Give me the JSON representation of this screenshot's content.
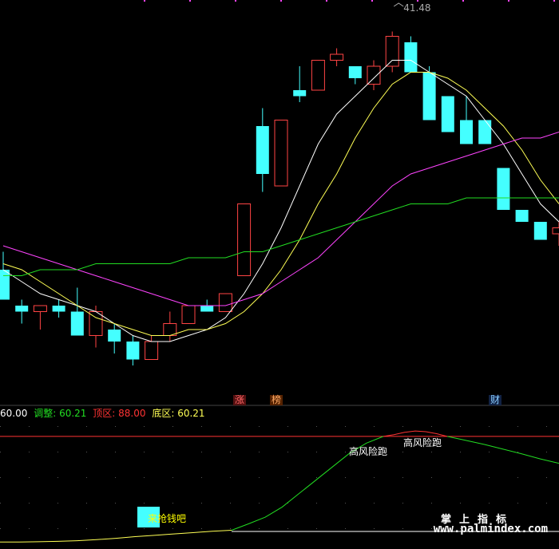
{
  "indicator": {
    "items": [
      {
        "label": "",
        "value": "60.00",
        "color": "#ffffff"
      },
      {
        "label": "调整:",
        "value": "60.21",
        "color": "#22dd22"
      },
      {
        "label": "顶区:",
        "value": "88.00",
        "color": "#ff3333"
      },
      {
        "label": "底区:",
        "value": "60.21",
        "color": "#ffff55"
      }
    ]
  },
  "event_tags": [
    {
      "text": "涨",
      "color": "#ff6666",
      "bg": "#551111"
    },
    {
      "text": "榜",
      "color": "#ffaa66",
      "bg": "#552200"
    },
    {
      "text": "财",
      "color": "#88ccff",
      "bg": "#112244"
    }
  ],
  "signals": {
    "high_risk_1": "高风险跑",
    "high_risk_2": "高风险跑",
    "entry": "来抢钱吧"
  },
  "watermark": {
    "line1": "掌上指标",
    "line2": "www.palmindex.com"
  },
  "chart_data": [
    {
      "type": "candlestick",
      "title": "",
      "annotations": [
        {
          "text": "41.48",
          "at_candle": 21,
          "type": "high"
        }
      ],
      "candles": [
        {
          "o": 37.5,
          "h": 37.8,
          "l": 37.0,
          "c": 37.0
        },
        {
          "o": 36.9,
          "h": 37.0,
          "l": 36.6,
          "c": 36.8
        },
        {
          "o": 36.8,
          "h": 36.9,
          "l": 36.5,
          "c": 36.9
        },
        {
          "o": 36.9,
          "h": 37.0,
          "l": 36.7,
          "c": 36.8
        },
        {
          "o": 36.8,
          "h": 37.2,
          "l": 36.4,
          "c": 36.4
        },
        {
          "o": 36.4,
          "h": 36.9,
          "l": 36.2,
          "c": 36.8
        },
        {
          "o": 36.5,
          "h": 36.6,
          "l": 36.1,
          "c": 36.3
        },
        {
          "o": 36.3,
          "h": 36.4,
          "l": 35.9,
          "c": 36.0
        },
        {
          "o": 36.0,
          "h": 36.4,
          "l": 36.0,
          "c": 36.3
        },
        {
          "o": 36.4,
          "h": 36.8,
          "l": 36.3,
          "c": 36.6
        },
        {
          "o": 36.6,
          "h": 36.9,
          "l": 36.6,
          "c": 36.9
        },
        {
          "o": 36.9,
          "h": 37.0,
          "l": 36.8,
          "c": 36.8
        },
        {
          "o": 36.8,
          "h": 37.1,
          "l": 36.8,
          "c": 37.1
        },
        {
          "o": 37.4,
          "h": 38.6,
          "l": 37.4,
          "c": 38.6
        },
        {
          "o": 39.9,
          "h": 40.2,
          "l": 38.8,
          "c": 39.1
        },
        {
          "o": 38.9,
          "h": 39.9,
          "l": 38.9,
          "c": 40.0
        },
        {
          "o": 40.5,
          "h": 40.9,
          "l": 40.3,
          "c": 40.4
        },
        {
          "o": 40.5,
          "h": 41.0,
          "l": 40.5,
          "c": 41.0
        },
        {
          "o": 41.0,
          "h": 41.2,
          "l": 40.9,
          "c": 41.1
        },
        {
          "o": 40.9,
          "h": 40.9,
          "l": 40.6,
          "c": 40.7
        },
        {
          "o": 40.6,
          "h": 41.0,
          "l": 40.5,
          "c": 40.9
        },
        {
          "o": 40.9,
          "h": 41.48,
          "l": 40.8,
          "c": 41.4
        },
        {
          "o": 41.3,
          "h": 41.4,
          "l": 40.8,
          "c": 40.8
        },
        {
          "o": 40.8,
          "h": 40.9,
          "l": 40.0,
          "c": 40.0
        },
        {
          "o": 40.4,
          "h": 40.4,
          "l": 39.8,
          "c": 39.8
        },
        {
          "o": 40.0,
          "h": 40.4,
          "l": 39.6,
          "c": 39.6
        },
        {
          "o": 40.0,
          "h": 40.0,
          "l": 39.6,
          "c": 39.6
        },
        {
          "o": 39.2,
          "h": 39.2,
          "l": 38.5,
          "c": 38.5
        },
        {
          "o": 38.5,
          "h": 38.5,
          "l": 38.3,
          "c": 38.3
        },
        {
          "o": 38.3,
          "h": 38.3,
          "l": 38.0,
          "c": 38.0
        },
        {
          "o": 38.1,
          "h": 38.3,
          "l": 37.9,
          "c": 38.2
        }
      ],
      "ma_lines": [
        {
          "color": "#ffffff",
          "values": [
            37.5,
            37.3,
            37.1,
            37.0,
            36.9,
            36.8,
            36.6,
            36.4,
            36.3,
            36.3,
            36.4,
            36.5,
            36.7,
            37.1,
            37.6,
            38.2,
            38.9,
            39.6,
            40.1,
            40.4,
            40.7,
            41.0,
            41.0,
            40.8,
            40.6,
            40.4,
            40.0,
            39.6,
            39.1,
            38.6,
            38.3
          ]
        },
        {
          "color": "#ffff55",
          "values": [
            37.6,
            37.5,
            37.3,
            37.1,
            36.9,
            36.7,
            36.6,
            36.5,
            36.4,
            36.4,
            36.5,
            36.5,
            36.6,
            36.8,
            37.1,
            37.5,
            38.0,
            38.6,
            39.1,
            39.7,
            40.2,
            40.6,
            40.8,
            40.8,
            40.7,
            40.5,
            40.2,
            39.9,
            39.5,
            39.0,
            38.6
          ]
        },
        {
          "color": "#ff44ff",
          "values": [
            37.9,
            37.8,
            37.7,
            37.6,
            37.5,
            37.4,
            37.3,
            37.2,
            37.1,
            37.0,
            36.9,
            36.9,
            36.9,
            37.0,
            37.1,
            37.3,
            37.5,
            37.7,
            38.0,
            38.3,
            38.6,
            38.9,
            39.1,
            39.2,
            39.3,
            39.4,
            39.5,
            39.6,
            39.7,
            39.7,
            39.8
          ]
        },
        {
          "color": "#22dd22",
          "values": [
            37.4,
            37.4,
            37.5,
            37.5,
            37.5,
            37.6,
            37.6,
            37.6,
            37.6,
            37.6,
            37.7,
            37.7,
            37.7,
            37.8,
            37.8,
            37.9,
            38.0,
            38.1,
            38.2,
            38.3,
            38.4,
            38.5,
            38.6,
            38.6,
            38.6,
            38.7,
            38.7,
            38.7,
            38.7,
            38.7,
            38.7
          ]
        }
      ],
      "ylim": [
        35.5,
        41.9
      ]
    },
    {
      "type": "line",
      "title": "",
      "ylim": [
        55,
        92
      ],
      "levels": [
        {
          "value": 88.0,
          "color": "#ff3333",
          "style": "solid"
        },
        {
          "value": 60.21,
          "color": "#ffff55",
          "style": "solid"
        }
      ],
      "series": [
        {
          "color": "#ffff55",
          "values": [
            56.6,
            56.6,
            56.7,
            56.8,
            57.0,
            57.3,
            57.7,
            58.2,
            58.6,
            59.0,
            59.4,
            59.8,
            60.1
          ]
        },
        {
          "color": "#22dd22",
          "values": [
            60.1,
            62.0,
            64.0,
            67.0,
            71.0,
            75.0,
            79.0,
            83.0,
            86.0,
            88.0
          ]
        },
        {
          "color": "#ff3333",
          "values": [
            88.0,
            88.5,
            89.2,
            89.6,
            89.4,
            88.8,
            88.0
          ]
        },
        {
          "color": "#22dd22",
          "values": [
            88.0,
            86.8,
            85.6,
            84.2,
            82.8,
            81.3,
            80.0
          ]
        }
      ]
    }
  ]
}
